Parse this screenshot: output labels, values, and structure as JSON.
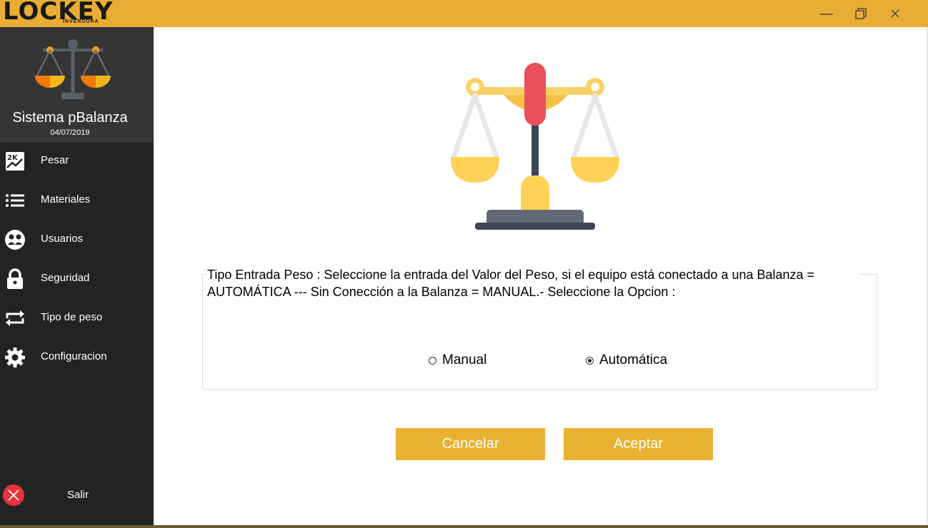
{
  "titlebar": {
    "brand": "LOCKEY",
    "brand_sub": "INVERSORA",
    "controls": [
      "minimize-icon",
      "maximize-icon",
      "close-icon"
    ],
    "color": "#e8ad34"
  },
  "sidebar": {
    "app_name": "Sistema pBalanza",
    "date": "04/07/2019",
    "items": [
      {
        "label": "Pesar",
        "icon": "chart-2k-icon"
      },
      {
        "label": "Materiales",
        "icon": "list-icon"
      },
      {
        "label": "Usuarios",
        "icon": "users-icon"
      },
      {
        "label": "Seguridad",
        "icon": "lock-icon"
      },
      {
        "label": "Tipo de peso",
        "icon": "repeat-icon"
      },
      {
        "label": "Configuracion",
        "icon": "gear-icon"
      }
    ],
    "exit_label": "Salir",
    "exit_icon": "close-circle-icon"
  },
  "main": {
    "groupbox_legend": "Tipo Entrada Peso : Seleccione la entrada del Valor del Peso, si el equipo está conectado a una Balanza = AUTOMÁTICA --- Sin Conección a la Balanza = MANUAL.-  Seleccione la Opcion :",
    "options": [
      {
        "label": "Manual",
        "selected": false
      },
      {
        "label": "Automática",
        "selected": true
      }
    ],
    "cancel_label": "Cancelar",
    "accept_label": "Aceptar",
    "button_color": "#e8b232"
  }
}
